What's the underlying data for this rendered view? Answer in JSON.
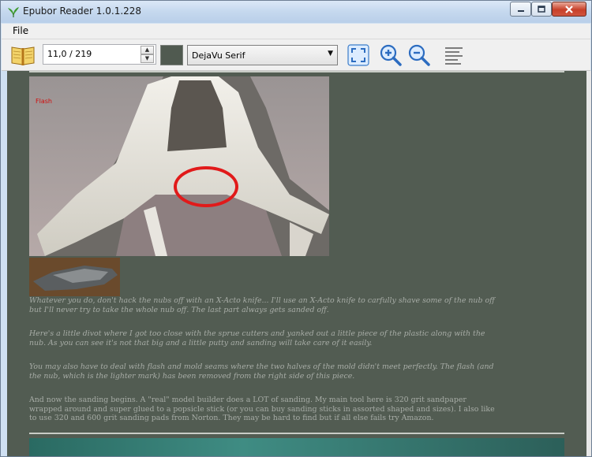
{
  "window": {
    "title": "Epubor Reader 1.0.1.228"
  },
  "menu": {
    "items": [
      "File"
    ]
  },
  "toolbar": {
    "page_value": "11,0 / 219",
    "font_value": "DejaVu Serif",
    "background_color": "#505a50",
    "icons": {
      "book": "open-book-icon",
      "fit": "fit-screen-icon",
      "zoom_in": "zoom-in-icon",
      "zoom_out": "zoom-out-icon",
      "toc": "table-of-contents-icon"
    }
  },
  "content": {
    "background": "#525c52",
    "thumbnail_caption": "Flash",
    "paragraphs": [
      "Whatever you do, don't hack the nubs off with an X-Acto knife... I'll use an X-Acto knife to carfully shave some of the nub off but I'll never try to take the whole nub off. The last part always gets sanded off.",
      "Here's a little divot where I got too close with the sprue cutters and yanked out a little piece of the plastic along with the nub. As you can see it's not that big and a little putty and sanding will take care of it easily.",
      "You may also have to deal with flash and mold seams where the two halves of the mold didn't meet perfectly. The flash (and the nub, which is the lighter mark) has been removed from the right side of this piece.",
      "And now the sanding begins. A \"real\" model builder does a LOT of sanding. My main tool here is 320 grit sandpaper wrapped around and super glued to a popsicle stick (or you can buy sanding sticks in assorted shaped and sizes). I also like to use 320 and 600 grit sanding pads from Norton. They may be hard to find but if all else fails try Amazon."
    ]
  }
}
